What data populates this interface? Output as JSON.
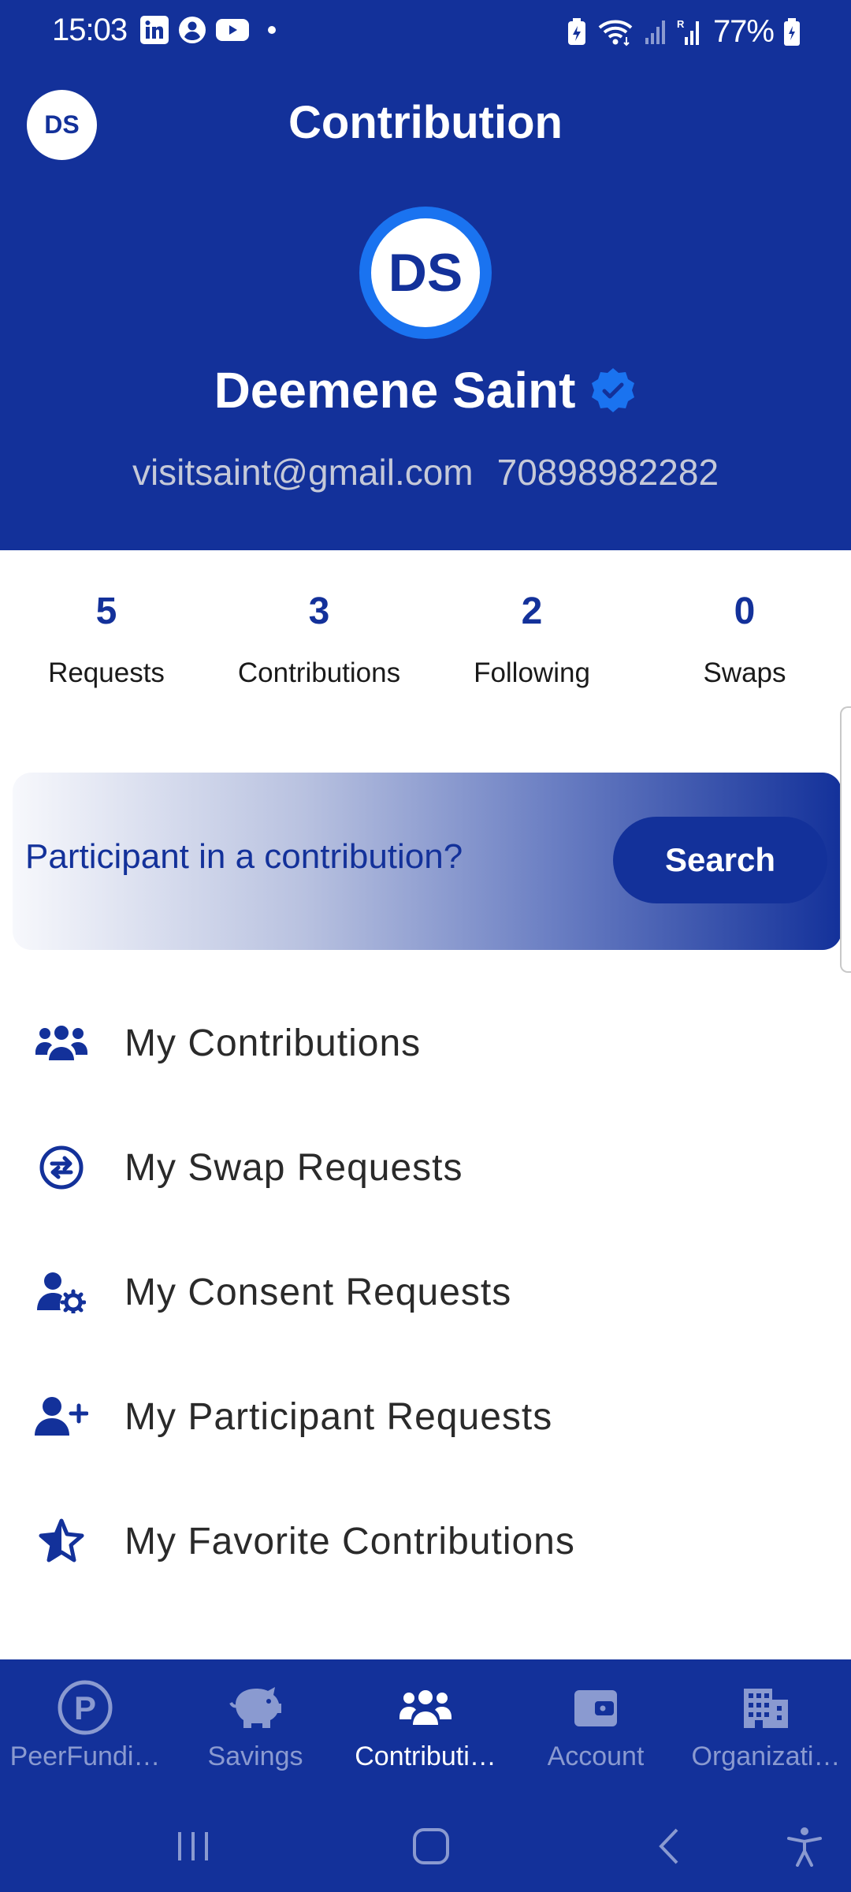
{
  "status_bar": {
    "time": "15:03",
    "battery": "77%",
    "left_icons": [
      "linkedin-icon",
      "account-circle-icon",
      "youtube-icon",
      "notification-dot"
    ],
    "right_icons": [
      "battery-saver-icon",
      "wifi-icon",
      "signal-icon",
      "roaming-signal-icon",
      "battery-icon"
    ]
  },
  "header": {
    "title": "Contribution",
    "avatar_initials": "DS"
  },
  "profile": {
    "initials": "DS",
    "name": "Deemene Saint",
    "verified": true,
    "email": "visitsaint@gmail.com",
    "phone": "70898982282"
  },
  "stats": [
    {
      "value": "5",
      "label": "Requests"
    },
    {
      "value": "3",
      "label": "Contributions"
    },
    {
      "value": "2",
      "label": "Following"
    },
    {
      "value": "0",
      "label": "Swaps"
    }
  ],
  "search_banner": {
    "prompt": "Participant in a contribution?",
    "button_label": "Search"
  },
  "menu": [
    {
      "label": "My Contributions",
      "icon": "group-icon"
    },
    {
      "label": "My Swap Requests",
      "icon": "swap-circle-icon"
    },
    {
      "label": "My Consent Requests",
      "icon": "user-gear-icon"
    },
    {
      "label": "My Participant Requests",
      "icon": "user-plus-icon"
    },
    {
      "label": "My Favorite Contributions",
      "icon": "star-icon"
    }
  ],
  "bottom_nav": [
    {
      "label": "PeerFundi…",
      "icon": "peerfunding-icon",
      "active": false
    },
    {
      "label": "Savings",
      "icon": "piggy-bank-icon",
      "active": false
    },
    {
      "label": "Contributi…",
      "icon": "group-icon",
      "active": true
    },
    {
      "label": "Account",
      "icon": "wallet-icon",
      "active": false
    },
    {
      "label": "Organizati…",
      "icon": "building-icon",
      "active": false
    }
  ],
  "colors": {
    "primary": "#13319a",
    "accent": "#1a73f0",
    "nav_inactive": "#8a9ad0"
  }
}
